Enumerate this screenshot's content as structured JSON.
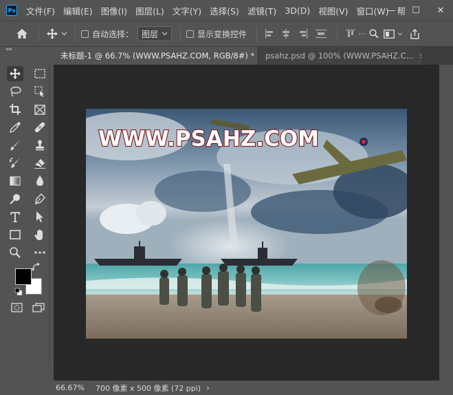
{
  "app": {
    "logo_text": "Ps"
  },
  "menu": {
    "items": [
      "文件(F)",
      "编辑(E)",
      "图像(I)",
      "图层(L)",
      "文字(Y)",
      "选择(S)",
      "滤镜(T)",
      "3D(D)",
      "视图(V)",
      "窗口(W)",
      "帮"
    ]
  },
  "window_controls": {
    "minimize": "—",
    "maximize": "☐",
    "close": "✕"
  },
  "options": {
    "auto_select_label": "自动选择：",
    "layer_select_value": "图层",
    "show_transform_label": "显示变换控件"
  },
  "tabs": [
    {
      "label": "未标题-1 @ 66.7% (WWW.PSAHZ.COM, RGB/8#) *",
      "close": "×"
    },
    {
      "label": "psahz.psd @ 100% (WWW.PSAHZ.C...",
      "close": "×"
    }
  ],
  "toolbar": {
    "collapse": "««"
  },
  "canvas": {
    "watermark_text": "WWW.PSAHZ.COM"
  },
  "status": {
    "zoom": "66.67%",
    "doc_info": "700 像素 x 500 像素 (72 ppi)",
    "arrow": "›"
  },
  "colors": {
    "foreground": "#000000",
    "background": "#ffffff",
    "accent": "#31a8ff"
  }
}
